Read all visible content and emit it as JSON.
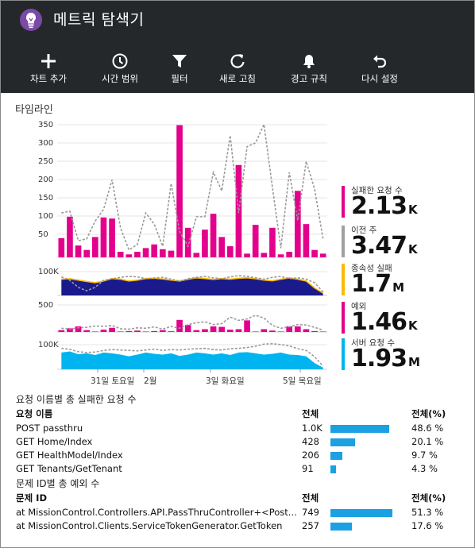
{
  "app": {
    "title": "메트릭 탐색기"
  },
  "toolbar": [
    {
      "id": "add-chart",
      "label": "차트 추가",
      "icon": "plus-icon"
    },
    {
      "id": "time-range",
      "label": "시간 범위",
      "icon": "clock-icon"
    },
    {
      "id": "filter",
      "label": "필터",
      "icon": "filter-icon"
    },
    {
      "id": "refresh",
      "label": "새로 고침",
      "icon": "refresh-icon"
    },
    {
      "id": "alert-rules",
      "label": "경고 규칙",
      "icon": "bell-icon"
    },
    {
      "id": "reset",
      "label": "다시 설정",
      "icon": "undo-icon"
    }
  ],
  "timeline": {
    "title": "타임라인",
    "x_labels": [
      "31일 토요일",
      "2월",
      "3일 화요일",
      "5일 목요일"
    ]
  },
  "metrics": [
    {
      "label": "실패한 요청 수",
      "value": "2.13",
      "unit": "K",
      "color": "#e3008c"
    },
    {
      "label": "이전 주",
      "value": "3.47",
      "unit": "K",
      "color": "#a0a0a0"
    },
    {
      "label": "종속성 실패",
      "value": "1.7",
      "unit": "M",
      "color": "#ffb900"
    },
    {
      "label": "예외",
      "value": "1.46",
      "unit": "K",
      "color": "#e3008c"
    },
    {
      "label": "서버 요청 수",
      "value": "1.93",
      "unit": "M",
      "color": "#00b4f0"
    }
  ],
  "chart_data": [
    {
      "type": "bar",
      "name": "failed-requests",
      "y_ticks": [
        "350",
        "300",
        "250",
        "200",
        "150",
        "100",
        "50"
      ],
      "ylim": [
        0,
        370
      ],
      "color": "#e3008c",
      "values": [
        52,
        110,
        32,
        20,
        55,
        108,
        105,
        15,
        8,
        15,
        25,
        35,
        22,
        18,
        358,
        80,
        12,
        75,
        118,
        55,
        30,
        250,
        10,
        88,
        12,
        80,
        8,
        15,
        180,
        90,
        20,
        10
      ],
      "previous": [
        120,
        125,
        45,
        50,
        98,
        130,
        210,
        80,
        20,
        35,
        120,
        90,
        30,
        200,
        70,
        30,
        110,
        110,
        230,
        180,
        330,
        120,
        300,
        310,
        360,
        190,
        25,
        230,
        100,
        260,
        185,
        50
      ]
    },
    {
      "type": "area",
      "name": "dependency-failures",
      "y_ticks": [
        "100K"
      ],
      "ylim": [
        0,
        130
      ],
      "color": "#1a1a8c",
      "line_color": "#ffb900",
      "values": [
        70,
        72,
        66,
        60,
        55,
        62,
        73,
        70,
        62,
        66,
        73,
        74,
        71,
        66,
        62,
        70,
        76,
        73,
        69,
        73,
        70,
        74,
        76,
        72,
        66,
        63,
        70,
        76,
        70,
        62,
        32,
        10
      ],
      "previous": [
        80,
        65,
        35,
        20,
        35,
        65,
        72,
        78,
        82,
        80,
        72,
        75,
        78,
        70,
        62,
        72,
        78,
        82,
        76,
        72,
        80,
        85,
        82,
        76,
        70,
        78,
        82,
        72,
        76,
        70,
        55,
        15
      ]
    },
    {
      "type": "bar",
      "name": "exceptions",
      "y_ticks": [
        "500"
      ],
      "ylim": [
        0,
        650
      ],
      "color": "#e3008c",
      "values": [
        40,
        80,
        120,
        40,
        10,
        50,
        90,
        10,
        20,
        30,
        10,
        20,
        40,
        15,
        260,
        150,
        40,
        60,
        120,
        110,
        50,
        60,
        250,
        10,
        60,
        30,
        10,
        120,
        120,
        60,
        20,
        10
      ],
      "previous": [
        80,
        60,
        90,
        100,
        130,
        120,
        140,
        70,
        60,
        90,
        80,
        110,
        60,
        120,
        80,
        160,
        200,
        220,
        160,
        180,
        320,
        250,
        280,
        360,
        300,
        140,
        80,
        110,
        160,
        150,
        100,
        40
      ]
    },
    {
      "type": "area",
      "name": "server-requests",
      "y_ticks": [
        "100K"
      ],
      "ylim": [
        0,
        140
      ],
      "color": "#00b4f0",
      "values": [
        80,
        85,
        72,
        76,
        68,
        80,
        76,
        70,
        62,
        70,
        80,
        74,
        70,
        76,
        64,
        70,
        80,
        76,
        70,
        76,
        68,
        80,
        82,
        76,
        70,
        74,
        80,
        70,
        68,
        62,
        30,
        8
      ],
      "previous": [
        100,
        95,
        84,
        80,
        82,
        90,
        94,
        92,
        90,
        88,
        92,
        96,
        90,
        94,
        92,
        96,
        98,
        100,
        94,
        92,
        98,
        100,
        104,
        110,
        120,
        122,
        118,
        112,
        98,
        90,
        60,
        15
      ]
    }
  ],
  "table_requests": {
    "title": "요청 이름별 총 실패한 요청 수",
    "col_name": "요청 이름",
    "col_count": "전체",
    "col_pct": "전체(%)",
    "rows": [
      {
        "name": "POST passthru",
        "count": "1.0K",
        "pct": "48.6 %",
        "fraction": 0.486
      },
      {
        "name": "GET Home/Index",
        "count": "428",
        "pct": "20.1 %",
        "fraction": 0.201
      },
      {
        "name": "GET HealthModel/Index",
        "count": "206",
        "pct": "9.7 %",
        "fraction": 0.097
      },
      {
        "name": "GET Tenants/GetTenant",
        "count": "91",
        "pct": "4.3 %",
        "fraction": 0.043
      }
    ]
  },
  "table_problems": {
    "title": "문제 ID별 총 예외 수",
    "col_name": "문제 ID",
    "col_count": "전체",
    "col_pct": "전체(%)",
    "rows": [
      {
        "name": "at MissionControl.Controllers.API.PassThruController+<Post...",
        "count": "749",
        "pct": "51.3 %",
        "fraction": 0.513
      },
      {
        "name": "at MissionControl.Clients.ServiceTokenGenerator.GetToken",
        "count": "257",
        "pct": "17.6 %",
        "fraction": 0.176
      }
    ]
  }
}
